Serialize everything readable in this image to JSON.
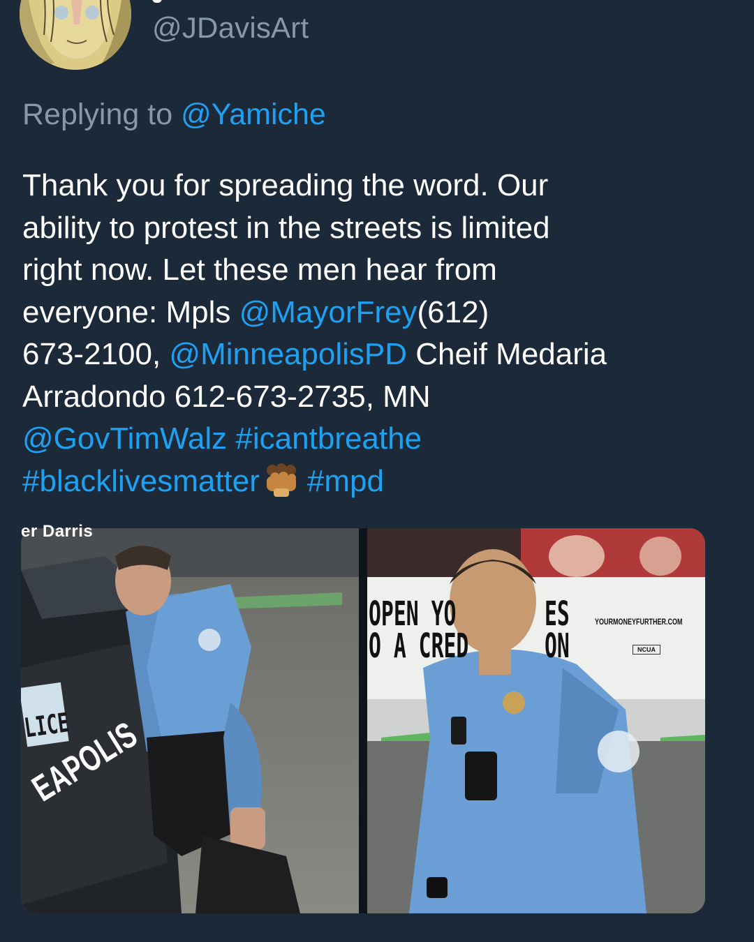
{
  "tweet": {
    "author_handle": "@JDavisArt",
    "replying_prefix": "Replying to ",
    "replying_to": "@Yamiche",
    "text_lines": [
      "Thank you for spreading the word. Our",
      "ability to protest in the streets is limited",
      "right now. Let these men hear from"
    ],
    "line4_pre": "everyone: Mpls ",
    "mention_mayor": "@MayorFrey",
    "line4_post": "(612)",
    "line5_pre": "673-2100, ",
    "mention_pd": "@MinneapolisPD",
    "line5_post": " Cheif Medaria",
    "line6": "Arradondo 612-673-2735, MN",
    "mention_gov": "@GovTimWalz",
    "hashtag_1": " #icantbreathe",
    "hashtag_2": "#blacklivesmatter",
    "hashtag_3": "#mpd",
    "fist_icon": "raised-fist-emoji-icon"
  },
  "media": {
    "left_caption": "er Darris",
    "bus_open": "OPEN YO",
    "bus_cred": "O A CRED",
    "bus_es": "ES",
    "bus_on": "ON",
    "bus_url": "YOURMONEYFURTHER.COM",
    "bus_ncua": "NCUA",
    "car_lice": "LICE",
    "car_eapolis": "EAPOLIS"
  },
  "colors": {
    "background": "#1c2938",
    "link": "#1da1f2",
    "secondary_text": "#8899a6",
    "primary_text": "#ffffff"
  }
}
